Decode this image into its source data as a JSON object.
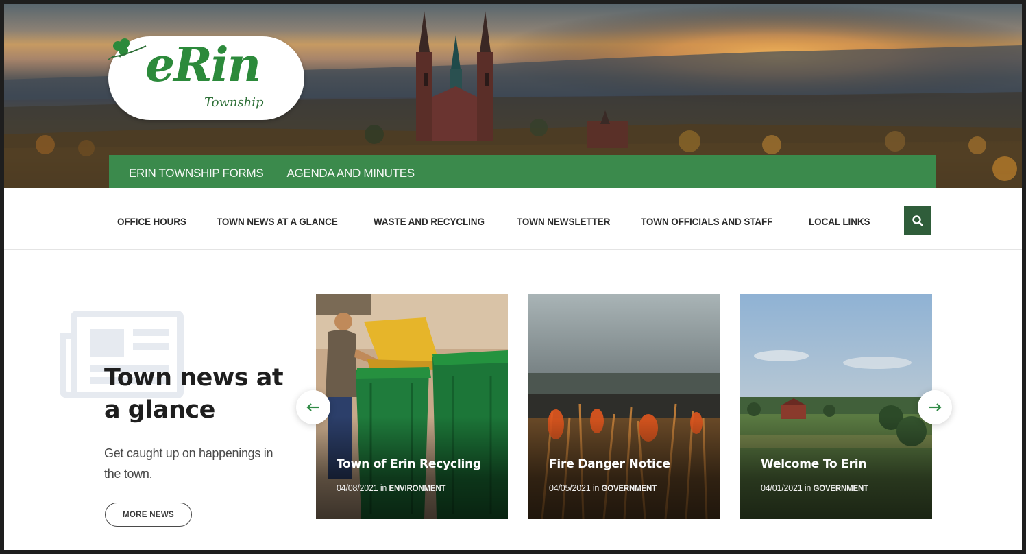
{
  "logo": {
    "word": "eRin",
    "sub": "Township"
  },
  "top_menu": [
    "ERIN TOWNSHIP FORMS",
    "AGENDA AND MINUTES"
  ],
  "main_nav": [
    "OFFICE HOURS",
    "TOWN NEWS AT A GLANCE",
    "WASTE AND RECYCLING",
    "TOWN NEWSLETTER",
    "TOWN OFFICIALS AND STAFF",
    "LOCAL LINKS"
  ],
  "icons": {
    "search": "search-icon",
    "prev": "arrow-left-icon",
    "next": "arrow-right-icon",
    "news": "newspaper-icon"
  },
  "news_section": {
    "title": "Town news at a glance",
    "description": "Get caught up on happenings in the town.",
    "button": "MORE NEWS"
  },
  "cards": [
    {
      "title": "Town of Erin Recycling",
      "date": "04/08/2021",
      "in": "in",
      "category": "ENVIRONMENT"
    },
    {
      "title": "Fire Danger Notice",
      "date": "04/05/2021",
      "in": "in",
      "category": "GOVERNMENT"
    },
    {
      "title": "Welcome To Erin",
      "date": "04/01/2021",
      "in": "in",
      "category": "GOVERNMENT"
    }
  ],
  "colors": {
    "brand_green": "#3b8a4c",
    "search_bg": "#2f5d3a",
    "arrow": "#2f8a45"
  }
}
